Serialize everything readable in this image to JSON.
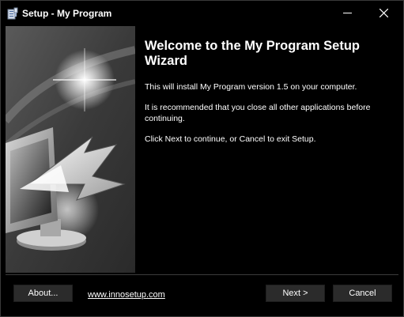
{
  "window": {
    "title": "Setup - My Program",
    "icon": "setup-installer-icon",
    "controls": {
      "minimize_icon": "minimize-icon",
      "close_icon": "close-icon"
    }
  },
  "banner": {
    "image": "wizard-monitor-arrow-image"
  },
  "welcome": {
    "title": "Welcome to the My Program Setup Wizard",
    "paragraphs": [
      "This will install My Program version 1.5 on your computer.",
      "It is recommended that you close all other applications before continuing.",
      "Click Next to continue, or Cancel to exit Setup."
    ]
  },
  "footer": {
    "about_label": "About...",
    "link_text": "www.innosetup.com",
    "next_label": "Next >",
    "cancel_label": "Cancel"
  },
  "colors": {
    "background": "#000000",
    "button": "#2b2b2b",
    "text": "#ffffff"
  }
}
